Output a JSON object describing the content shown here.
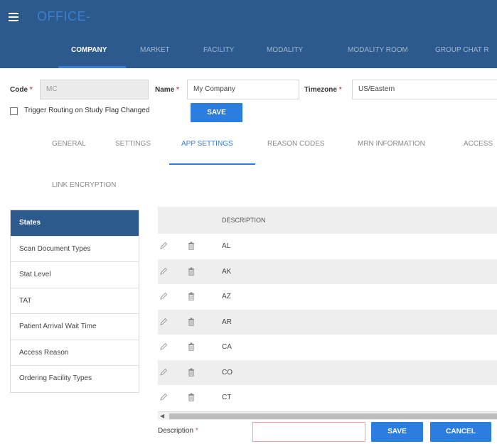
{
  "app": {
    "title": "OFFICE-"
  },
  "nav": {
    "items": [
      {
        "label": "COMPANY"
      },
      {
        "label": "MARKET"
      },
      {
        "label": "FACILITY"
      },
      {
        "label": "MODALITY"
      },
      {
        "label": "MODALITY ROOM"
      },
      {
        "label": "GROUP CHAT R"
      }
    ],
    "active": "COMPANY"
  },
  "form": {
    "code_label": "Code",
    "code_value": "MC",
    "name_label": "Name",
    "name_value": "My Company",
    "timezone_label": "Timezone",
    "timezone_value": "US/Eastern",
    "required_mark": "*",
    "trigger_label": "Trigger Routing on Study Flag Changed",
    "trigger_checked": false,
    "save_label": "SAVE"
  },
  "subtabs": {
    "items": [
      {
        "label": "GENERAL"
      },
      {
        "label": "SETTINGS"
      },
      {
        "label": "APP SETTINGS"
      },
      {
        "label": "REASON CODES"
      },
      {
        "label": "MRN INFORMATION"
      },
      {
        "label": "ACCESS"
      },
      {
        "label": "LINK ENCRYPTION"
      }
    ],
    "active": "APP SETTINGS"
  },
  "left_list": {
    "items": [
      {
        "label": "States"
      },
      {
        "label": "Scan Document Types"
      },
      {
        "label": "Stat Level"
      },
      {
        "label": "TAT"
      },
      {
        "label": "Patient Arrival Wait Time"
      },
      {
        "label": "Access Reason"
      },
      {
        "label": "Ordering Facility Types"
      }
    ],
    "active": "States"
  },
  "table": {
    "header": "DESCRIPTION",
    "rows": [
      "AL",
      "AK",
      "AZ",
      "AR",
      "CA",
      "CO",
      "CT"
    ]
  },
  "footer_form": {
    "description_label": "Description",
    "required_mark": "*",
    "description_value": "",
    "save_label": "SAVE",
    "cancel_label": "CANCEL"
  },
  "colors": {
    "header_bg": "#2d5a8c",
    "accent": "#2c7de0",
    "required": "#d9534f"
  }
}
